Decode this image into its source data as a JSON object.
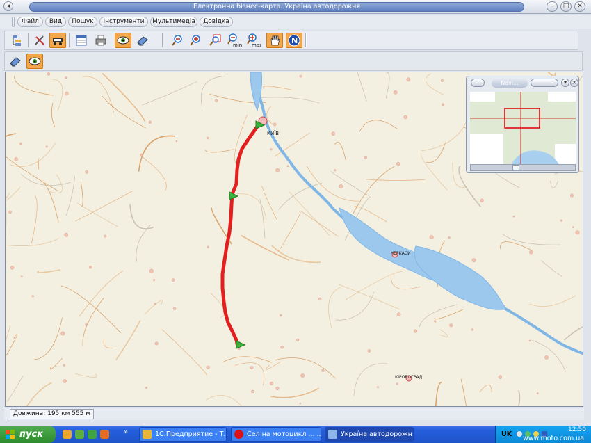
{
  "window": {
    "title": "Електронна бізнес-карта. Україна автодорожня",
    "minimize_glyph": "–",
    "maximize_glyph": "□",
    "close_glyph": "✕"
  },
  "menu": [
    "Файл",
    "Вид",
    "Пошук",
    "Інструменти",
    "Мультимедіа",
    "Довідка"
  ],
  "toolbar": {
    "buttons": [
      "layers-icon",
      "tools-icon",
      "vehicle-icon",
      "table-icon",
      "print-icon",
      "eye-icon",
      "eraser-icon",
      "zoom-out-icon",
      "zoom-in-icon",
      "zoom-window-icon",
      "zoom-min-icon",
      "zoom-max-icon",
      "pan-hand-icon",
      "north-icon"
    ],
    "zoom_min_label": "min",
    "zoom_max_label": "max",
    "north_label": "N"
  },
  "map": {
    "cities": [
      "КИЇВ",
      "ЧЕРКАСИ",
      "КІРОВОГРАД"
    ],
    "route_color": "#e32020"
  },
  "overview": {
    "title": "Navi..."
  },
  "status": {
    "length": "Довжина: 195 км 555 м"
  },
  "taskbar": {
    "start_label": "пуск",
    "tasks": [
      "1С:Предприятие - Т...",
      "Сел на мотоцикл ... ...",
      "Україна автодорожня"
    ],
    "language": "UK",
    "time": "12:50",
    "watermark": "www.moto.com.ua"
  }
}
